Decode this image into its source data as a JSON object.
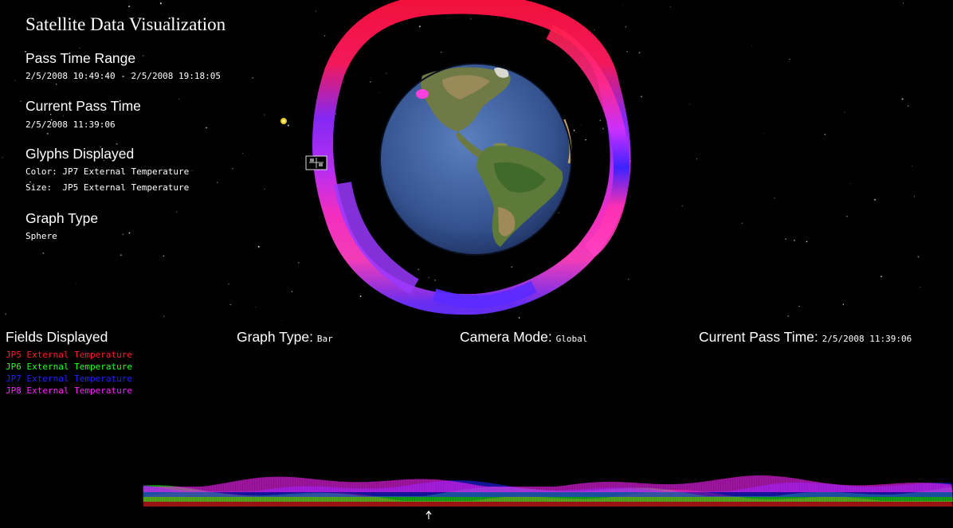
{
  "title": "Satellite Data Visualization",
  "info_panel": {
    "pass_time_range": {
      "heading": "Pass Time Range",
      "value": "2/5/2008 10:49:40 - 2/5/2008 19:18:05"
    },
    "current_pass_time": {
      "heading": "Current Pass Time",
      "value": "2/5/2008 11:39:06"
    },
    "glyphs_displayed": {
      "heading": "Glyphs Displayed",
      "color_line": "Color: JP7 External Temperature",
      "size_line": "Size:  JP5 External Temperature"
    },
    "graph_type": {
      "heading": "Graph Type",
      "value": "Sphere"
    }
  },
  "fields_displayed": {
    "heading": "Fields Displayed",
    "fields": [
      {
        "label": "JP5 External Temperature",
        "color": "#ff2020"
      },
      {
        "label": "JP6 External Temperature",
        "color": "#20ff20"
      },
      {
        "label": "JP7 External Temperature",
        "color": "#2020ff"
      },
      {
        "label": "JP8 External Temperature",
        "color": "#ff20ff"
      }
    ]
  },
  "status_bar": {
    "graph_type_label": "Graph Type:",
    "graph_type_value": "Bar",
    "camera_mode_label": "Camera Mode:",
    "camera_mode_value": "Global",
    "current_pass_time_label": "Current Pass Time:",
    "current_pass_time_value": "2/5/2008 11:39:06"
  },
  "colors": {
    "background": "#000000",
    "ring_red": "#ff1a40",
    "ring_magenta": "#ff30c0",
    "ring_blue": "#3a1aff",
    "ocean": "#3a5a9a"
  },
  "icons": {
    "satellite": "satellite-icon",
    "sun": "sun-icon",
    "time_marker": "up-arrow-icon"
  }
}
